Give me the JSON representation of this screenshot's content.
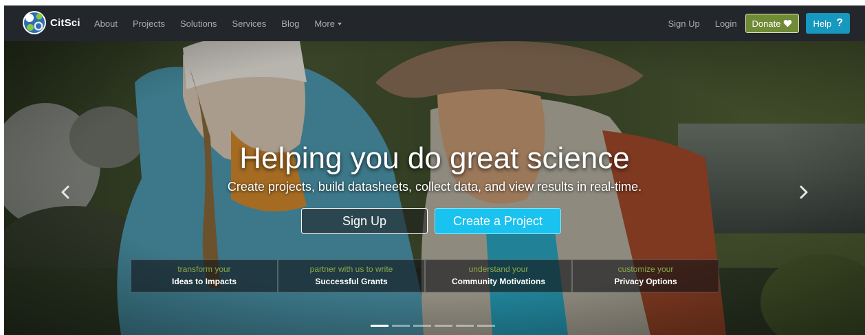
{
  "navbar": {
    "brand": "CitSci",
    "links": [
      "About",
      "Projects",
      "Solutions",
      "Services",
      "Blog",
      "More"
    ],
    "right_links": [
      "Sign Up",
      "Login"
    ],
    "donate_label": "Donate",
    "help_label": "Help",
    "help_glyph": "?",
    "icons": [
      "citsci-logo",
      "caret-down-icon",
      "heart-icon",
      "question-icon"
    ],
    "colors": {
      "navbar_bg": "#23262b",
      "donate_bg": "#6f8b36",
      "help_bg": "#1798bf"
    }
  },
  "hero": {
    "title": "Helping you do great science",
    "subtitle": "Create projects, build datasheets, collect data, and view results in real-time.",
    "signup_label": "Sign Up",
    "create_label": "Create a Project",
    "features": [
      {
        "small": "transform your",
        "big": "Ideas to Impacts"
      },
      {
        "small": "partner with us to write",
        "big": "Successful Grants"
      },
      {
        "small": "understand your",
        "big": "Community Motivations"
      },
      {
        "small": "customize your",
        "big": "Privacy Options"
      }
    ],
    "slide_count": 6,
    "active_slide": 0,
    "icons": [
      "chevron-left-icon",
      "chevron-right-icon"
    ],
    "colors": {
      "create_bg": "#19c2ef",
      "feature_small_text": "#8aa94a"
    }
  }
}
